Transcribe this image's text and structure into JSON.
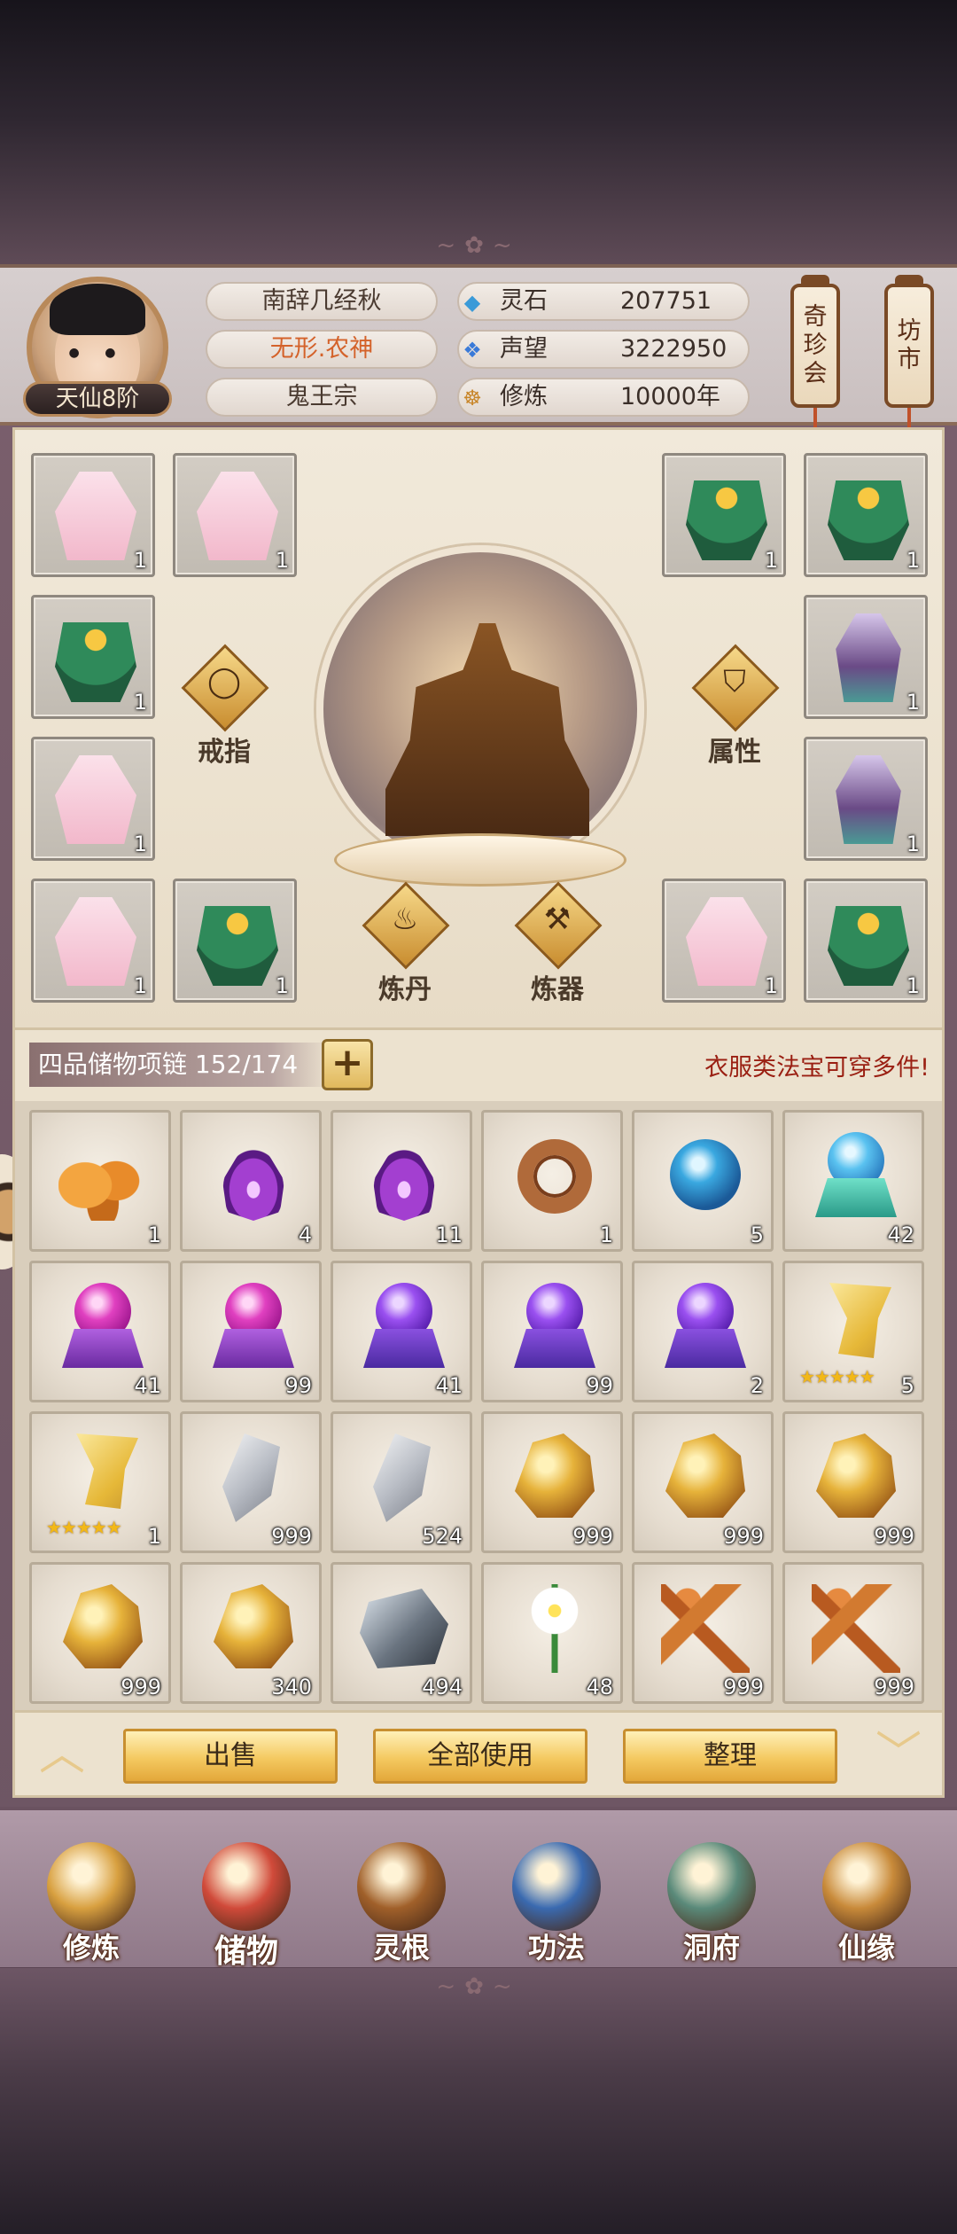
{
  "header": {
    "realm": "天仙8阶",
    "name": "南辞几经秋",
    "title": "无形.农神",
    "sect": "鬼王宗",
    "stats": [
      {
        "icon": "spirit-stone-icon",
        "label": "灵石",
        "value": "207751"
      },
      {
        "icon": "reputation-icon",
        "label": "声望",
        "value": "3222950"
      },
      {
        "icon": "cultivation-icon",
        "label": "修炼",
        "value": "10000年"
      }
    ],
    "lantern_left": [
      "奇",
      "珍",
      "会"
    ],
    "lantern_right": [
      "坊",
      "市"
    ]
  },
  "equipment": {
    "left_slots": [
      {
        "art": "robe-pink",
        "count": "1"
      },
      {
        "art": "robe-pink",
        "count": "1"
      },
      {
        "art": "robe-green",
        "count": "1"
      },
      {
        "art": "robe-pink",
        "count": "1"
      },
      {
        "art": "robe-pink",
        "count": "1"
      },
      {
        "art": "robe-green",
        "count": "1"
      }
    ],
    "right_slots": [
      {
        "art": "robe-green",
        "count": "1"
      },
      {
        "art": "robe-green",
        "count": "1"
      },
      {
        "art": "robe-purple",
        "count": "1"
      },
      {
        "art": "robe-purple",
        "count": "1"
      },
      {
        "art": "robe-pink",
        "count": "1"
      },
      {
        "art": "robe-green",
        "count": "1"
      }
    ],
    "buttons": {
      "ring": "戒指",
      "attributes": "属性",
      "alchemy": "炼丹",
      "forging": "炼器"
    }
  },
  "bag": {
    "title": "四品储物项链 152/174",
    "plus": "+",
    "hint": "衣服类法宝可穿多件!",
    "items": [
      {
        "art": "fungus",
        "count": "1"
      },
      {
        "art": "flame",
        "count": "4"
      },
      {
        "art": "flame",
        "count": "11"
      },
      {
        "art": "ring",
        "count": "1"
      },
      {
        "art": "orb-blue",
        "count": "5"
      },
      {
        "art": "orb-teal",
        "count": "42"
      },
      {
        "art": "orb-magenta",
        "count": "41"
      },
      {
        "art": "orb-magenta",
        "count": "99"
      },
      {
        "art": "orb-violet",
        "count": "41"
      },
      {
        "art": "orb-violet",
        "count": "99"
      },
      {
        "art": "orb-violet",
        "count": "2"
      },
      {
        "art": "scroll",
        "count": "5",
        "stars": "★★★★★"
      },
      {
        "art": "scroll",
        "count": "1",
        "stars": "★★★★★"
      },
      {
        "art": "silver",
        "count": "999"
      },
      {
        "art": "silver",
        "count": "524"
      },
      {
        "art": "gold",
        "count": "999"
      },
      {
        "art": "gold",
        "count": "999"
      },
      {
        "art": "gold",
        "count": "999"
      },
      {
        "art": "gold",
        "count": "999"
      },
      {
        "art": "gold",
        "count": "340"
      },
      {
        "art": "ore",
        "count": "494"
      },
      {
        "art": "flower",
        "count": "48"
      },
      {
        "art": "root",
        "count": "999"
      },
      {
        "art": "root",
        "count": "999"
      }
    ]
  },
  "actions": {
    "sell": "出售",
    "use_all": "全部使用",
    "organize": "整理"
  },
  "nav": [
    {
      "label": "修炼",
      "icon": "cultivate-icon",
      "color": "#d8a040"
    },
    {
      "label": "储物",
      "icon": "storage-bag-icon",
      "color": "#d04a3a"
    },
    {
      "label": "灵根",
      "icon": "spirit-root-icon",
      "color": "#a0602a"
    },
    {
      "label": "功法",
      "icon": "technique-book-icon",
      "color": "#3a6ab0"
    },
    {
      "label": "洞府",
      "icon": "cave-dwelling-icon",
      "color": "#5a8a7a"
    },
    {
      "label": "仙缘",
      "icon": "gourd-icon",
      "color": "#c88a3a"
    }
  ]
}
